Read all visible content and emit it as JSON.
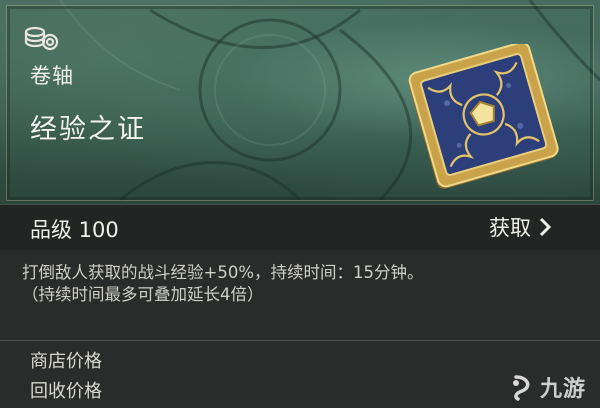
{
  "header": {
    "icon": "coins-icon",
    "category": "卷轴",
    "item_name": "经验之证",
    "item_art": "card-scroll-art"
  },
  "grade": {
    "label": "品级 100",
    "obtain_label": "获取",
    "obtain_icon": "chevron-right-icon"
  },
  "description": {
    "line1": "打倒敌人获取的战斗经验+50%，持续时间：15分钟。",
    "line2": "（持续时间最多可叠加延长4倍）"
  },
  "prices": {
    "shop_price": "商店价格",
    "recycle_price": "回收价格"
  },
  "watermark": {
    "logo": "jiuyou-logo-icon",
    "text": "九游"
  },
  "colors": {
    "header_green": "#3a5a4e",
    "card_blue": "#2d3f7a",
    "card_gold": "#c9a24a"
  }
}
